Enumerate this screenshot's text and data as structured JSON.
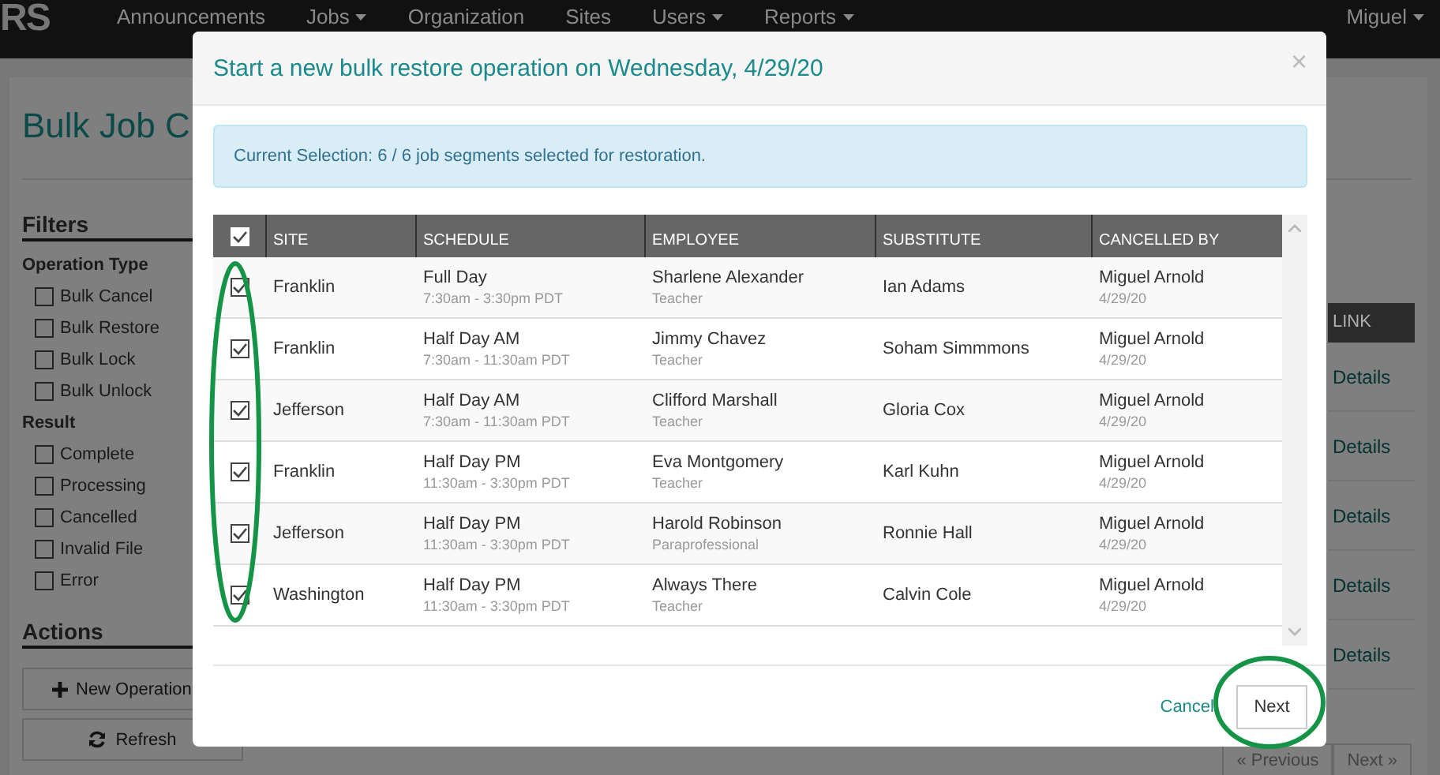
{
  "navbar": {
    "logo": "RS",
    "items": [
      {
        "label": "Announcements",
        "dropdown": false
      },
      {
        "label": "Jobs",
        "dropdown": true
      },
      {
        "label": "Organization",
        "dropdown": false
      },
      {
        "label": "Sites",
        "dropdown": false
      },
      {
        "label": "Users",
        "dropdown": true
      },
      {
        "label": "Reports",
        "dropdown": true
      }
    ],
    "user": {
      "label": "Miguel",
      "dropdown": true
    }
  },
  "page": {
    "title": "Bulk Job C",
    "filters": {
      "heading": "Filters",
      "groups": [
        {
          "heading": "Operation Type",
          "options": [
            {
              "label": "Bulk Cancel",
              "checked": false
            },
            {
              "label": "Bulk Restore",
              "checked": false
            },
            {
              "label": "Bulk Lock",
              "checked": false
            },
            {
              "label": "Bulk Unlock",
              "checked": false
            }
          ]
        },
        {
          "heading": "Result",
          "options": [
            {
              "label": "Complete",
              "checked": false
            },
            {
              "label": "Processing",
              "checked": false
            },
            {
              "label": "Cancelled",
              "checked": false
            },
            {
              "label": "Invalid File",
              "checked": false
            },
            {
              "label": "Error",
              "checked": false
            }
          ]
        }
      ]
    },
    "actions": {
      "heading": "Actions",
      "buttons": [
        {
          "label": "New Operation"
        },
        {
          "label": "Refresh"
        }
      ]
    },
    "table": {
      "column": "LINK",
      "rows": [
        "Details",
        "Details",
        "Details",
        "Details",
        "Details"
      ]
    },
    "pagination": [
      "« Previous",
      "Next »"
    ]
  },
  "modal": {
    "title": "Start a new bulk restore operation on Wednesday, 4/29/20",
    "close": "×",
    "alert": "Current Selection: 6 / 6 job segments selected for restoration.",
    "table": {
      "all_selected": true,
      "columns": [
        "SITE",
        "SCHEDULE",
        "EMPLOYEE",
        "SUBSTITUTE",
        "CANCELLED BY"
      ],
      "rows": [
        {
          "selected": true,
          "site": "Franklin",
          "schedule": "Full Day",
          "time": "7:30am - 3:30pm PDT",
          "employee": "Sharlene Alexander",
          "role": "Teacher",
          "substitute": "Ian Adams",
          "cancelled_by": "Miguel Arnold",
          "date": "4/29/20"
        },
        {
          "selected": true,
          "site": "Franklin",
          "schedule": "Half Day AM",
          "time": "7:30am - 11:30am PDT",
          "employee": "Jimmy Chavez",
          "role": "Teacher",
          "substitute": "Soham Simmmons",
          "cancelled_by": "Miguel Arnold",
          "date": "4/29/20"
        },
        {
          "selected": true,
          "site": "Jefferson",
          "schedule": "Half Day AM",
          "time": "7:30am - 11:30am PDT",
          "employee": "Clifford Marshall",
          "role": "Teacher",
          "substitute": "Gloria Cox",
          "cancelled_by": "Miguel Arnold",
          "date": "4/29/20"
        },
        {
          "selected": true,
          "site": "Franklin",
          "schedule": "Half Day PM",
          "time": "11:30am - 3:30pm PDT",
          "employee": "Eva Montgomery",
          "role": "Teacher",
          "substitute": "Karl Kuhn",
          "cancelled_by": "Miguel Arnold",
          "date": "4/29/20"
        },
        {
          "selected": true,
          "site": "Jefferson",
          "schedule": "Half Day PM",
          "time": "11:30am - 3:30pm PDT",
          "employee": "Harold Robinson",
          "role": "Paraprofessional",
          "substitute": "Ronnie Hall",
          "cancelled_by": "Miguel Arnold",
          "date": "4/29/20"
        },
        {
          "selected": true,
          "site": "Washington",
          "schedule": "Half Day PM",
          "time": "11:30am - 3:30pm PDT",
          "employee": "Always There",
          "role": "Teacher",
          "substitute": "Calvin Cole",
          "cancelled_by": "Miguel Arnold",
          "date": "4/29/20"
        }
      ]
    },
    "buttons": [
      {
        "label": "Cancel",
        "kind": "link"
      },
      {
        "label": "Next",
        "kind": "button"
      }
    ]
  },
  "highlights": [
    {
      "kind": "ellipse"
    },
    {
      "kind": "ellipse"
    }
  ]
}
